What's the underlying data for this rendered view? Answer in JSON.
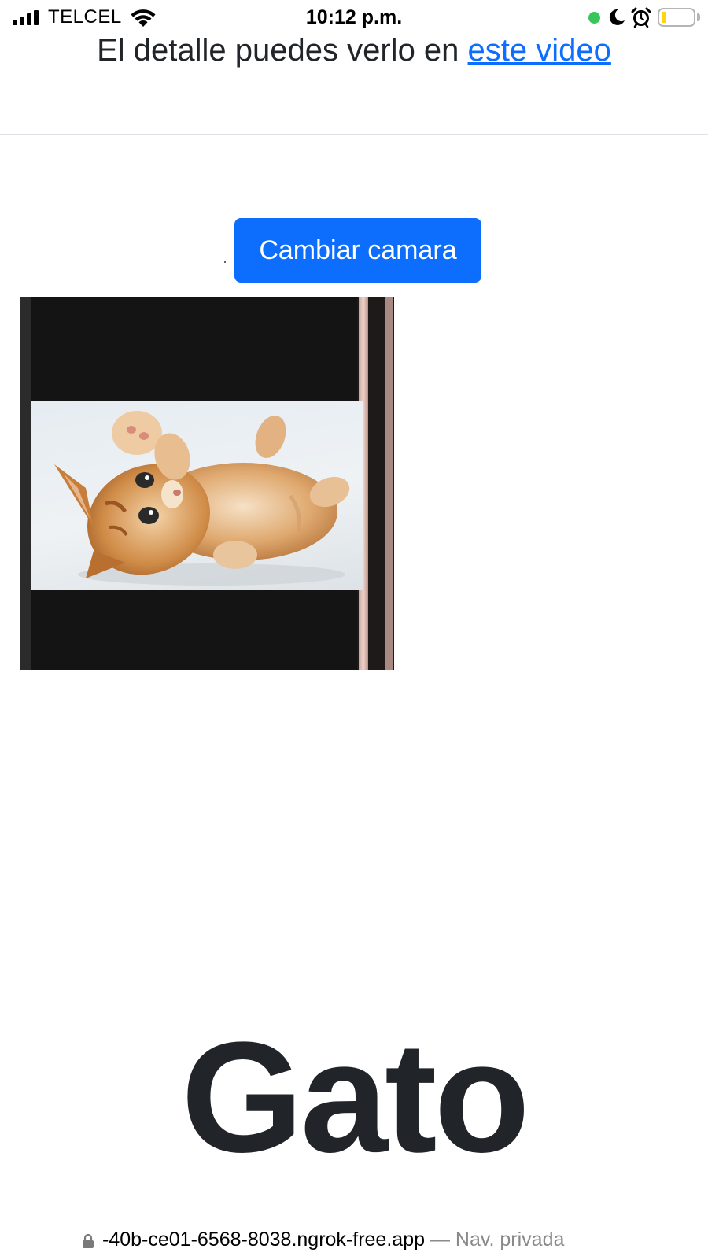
{
  "status_bar": {
    "carrier": "TELCEL",
    "time": "10:12 p.m.",
    "battery_level": 0.15,
    "colors": {
      "recording_dot": "#34c759",
      "battery_fill": "#ffd60a"
    }
  },
  "page": {
    "intro_text": "El detalle puedes verlo en",
    "intro_link": "este video",
    "switch_camera_label": "Cambiar camara",
    "prediction": "Gato",
    "colors": {
      "primary": "#0d6efd",
      "text": "#212529"
    }
  },
  "camera": {
    "icons": [
      "camera-feed-image",
      "kitten-photo"
    ]
  },
  "browser": {
    "url": "-40b-ce01-6568-8038.ngrok-free.app",
    "mode": "— Nav. privada"
  }
}
